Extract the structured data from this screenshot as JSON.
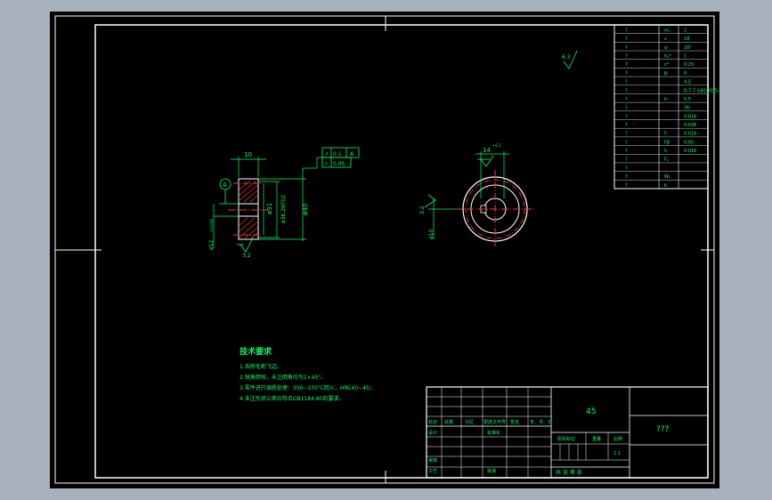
{
  "colors": {
    "frame": "#ffffff",
    "dim": "#00ff66",
    "center": "#ff3030",
    "text": "#00ff66",
    "background": "#000000"
  },
  "front_view": {
    "width_dim": "10",
    "datum": "A",
    "bore_dim": "ø12",
    "bore_tol_upper": "+0.018",
    "bore_tol_lower": "0",
    "hub_dim": "ø31",
    "root_dim": "ø36.26F02",
    "outer_dim": "ø40",
    "roughness_bottom": "3.2",
    "gdt_row1": [
      "↗",
      "0.1",
      "A"
    ],
    "gdt_row2": [
      "⌭",
      "0.05"
    ]
  },
  "side_view": {
    "keyway_dim": "14",
    "keyway_tol": "+0.1",
    "roughness_side": "3.2",
    "bore_label": "ø10"
  },
  "roughness_general": "6.3",
  "param_table": {
    "rows": [
      [
        "?",
        "mₙ",
        "2"
      ],
      [
        "?",
        "z",
        "18"
      ],
      [
        "?",
        "α",
        "20°"
      ],
      [
        "?",
        "hₐ*",
        "1"
      ],
      [
        "?",
        "c*",
        "0.25"
      ],
      [
        "?",
        "β",
        "0"
      ],
      [
        "?",
        "",
        "4.5"
      ],
      [
        "?",
        "",
        "8-7-7 GB10095-88"
      ],
      [
        "?",
        "h",
        "5.5"
      ],
      [
        "?",
        "",
        "36"
      ],
      [
        "?",
        "",
        "0.016"
      ],
      [
        "?",
        "",
        "0.036"
      ],
      [
        "?",
        "Fᵣ",
        "0.016"
      ],
      [
        "?",
        "Fβ",
        "0.05"
      ],
      [
        "?",
        "fₚ",
        "0.016"
      ],
      [
        "?",
        "Fₚ",
        ""
      ],
      [
        "?",
        "",
        ""
      ],
      [
        "?",
        "Wₖ",
        ""
      ],
      [
        "?",
        "k",
        ""
      ]
    ]
  },
  "tech_req": {
    "title": "技术要求",
    "items": [
      "1.去除毛刺飞边。",
      "2.锐角倒钝，未注倒角均为1×45°。",
      "3.零件进行调质处理：350~370°C回火，HRC40~45；",
      "4.未注形状公差应符合GB1184-80的要求。"
    ]
  },
  "title_block": {
    "material": "45",
    "name": "???",
    "scale": "1:1",
    "row_labels": [
      "标记",
      "处数",
      "分区",
      "更改文件号",
      "签名",
      "年、月、日"
    ],
    "designer": "设计",
    "standard": "标准化",
    "review": "审核",
    "process": "工艺",
    "approve": "批准",
    "stage": "阶段标记",
    "weight": "重量",
    "scale_label": "比例",
    "sheet": "共  张  第  张"
  }
}
